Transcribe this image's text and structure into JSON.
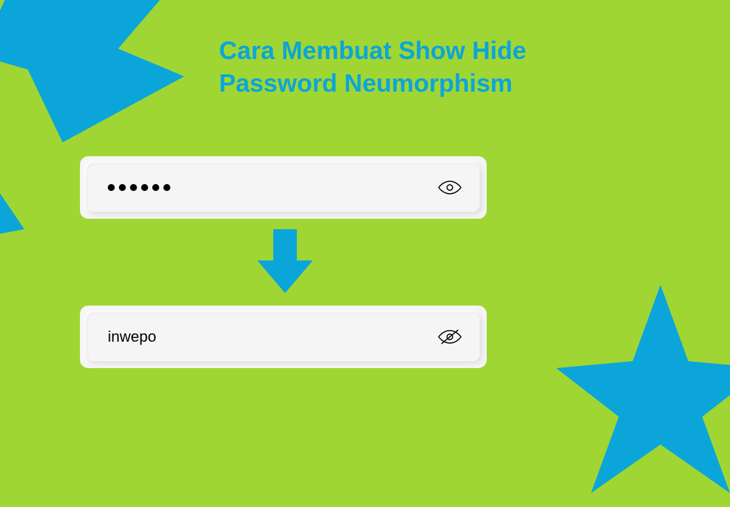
{
  "title_line1": "Cara Membuat Show Hide",
  "title_line2": "Password Neumorphism",
  "password_hidden": {
    "dots_count": 6
  },
  "password_shown": {
    "value": "inwepo"
  },
  "colors": {
    "background": "#a0d633",
    "accent": "#0ba5d9",
    "input_bg": "#f5f5f5"
  }
}
